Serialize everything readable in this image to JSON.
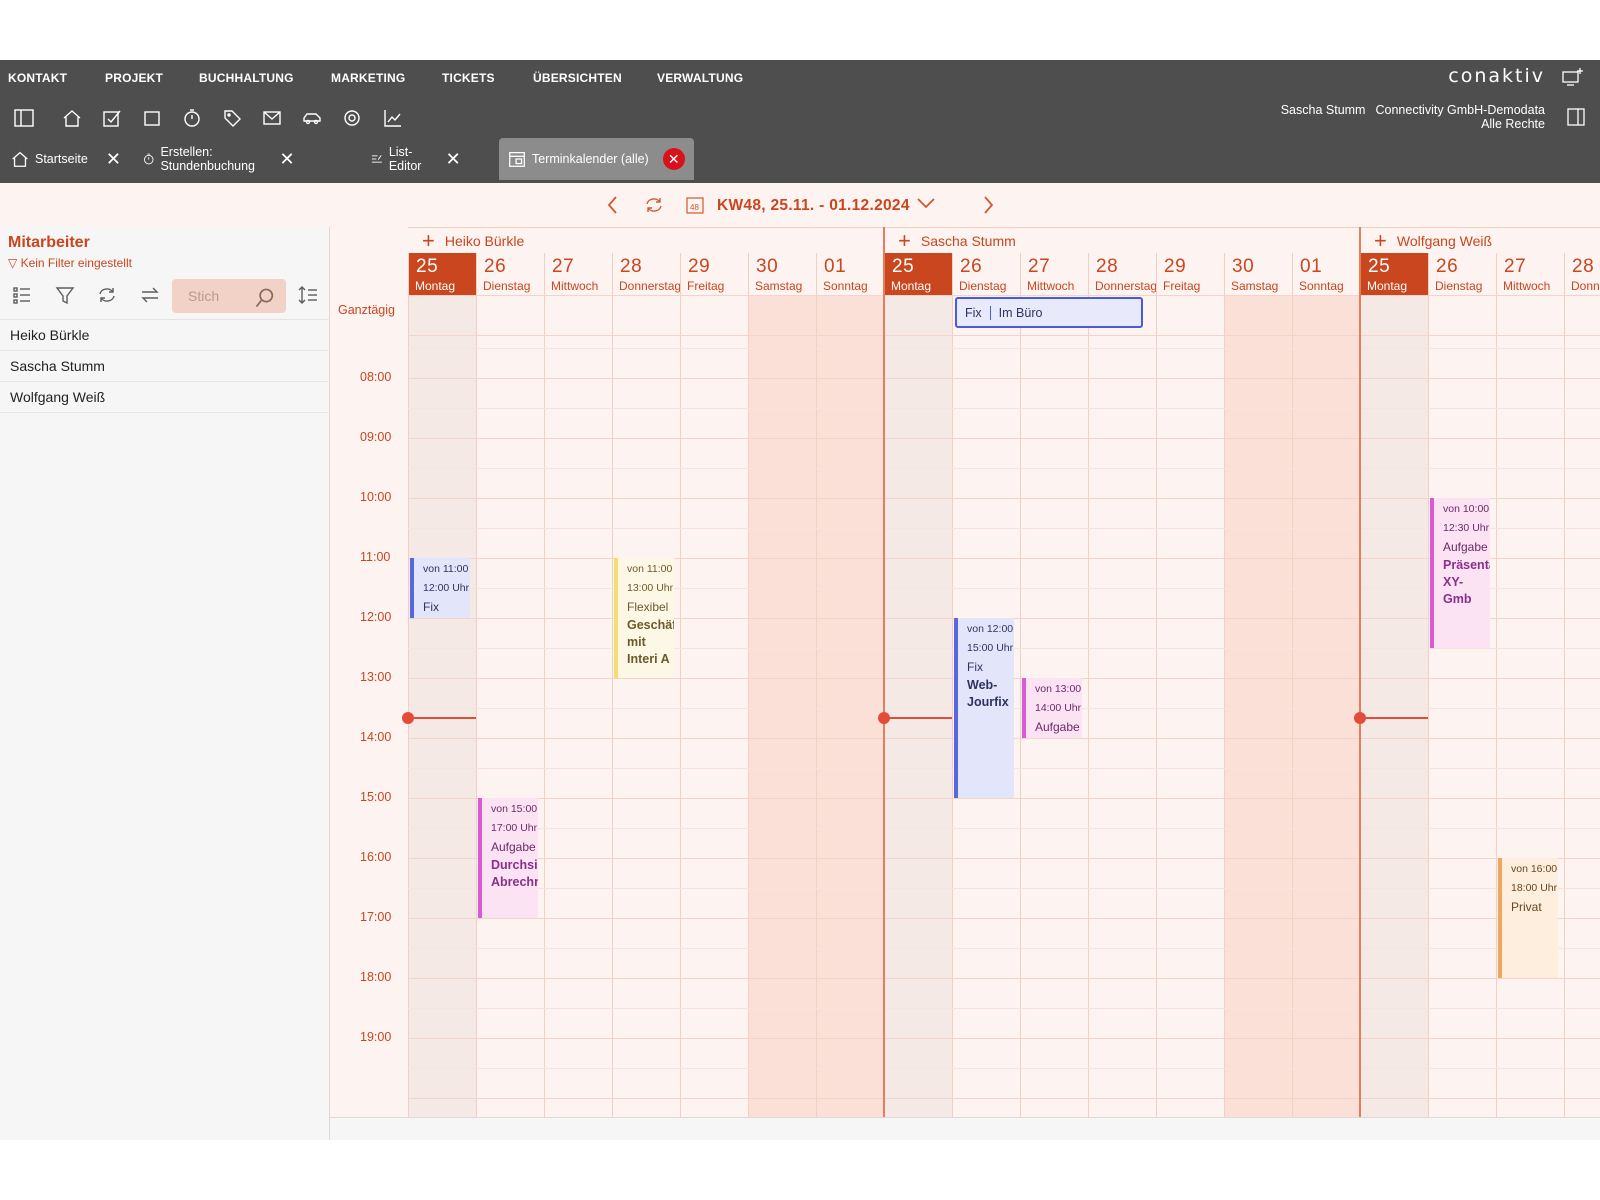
{
  "menu": [
    "KONTAKT",
    "PROJEKT",
    "BUCHHALTUNG",
    "MARKETING",
    "TICKETS",
    "ÜBERSICHTEN",
    "VERWALTUNG"
  ],
  "logo": "conaktiv",
  "user": {
    "name": "Sascha Stumm",
    "company": "Connectivity GmbH-Demodata",
    "rights": "Alle Rechte"
  },
  "toolbar_icons": [
    "panel-toggle-icon",
    "home-icon",
    "task-icon",
    "square-icon",
    "stopwatch-icon",
    "tag-icon",
    "mail-icon",
    "car-icon",
    "gear-icon",
    "chart-icon"
  ],
  "tabs": [
    {
      "label": "Startseite",
      "icon": "home-icon"
    },
    {
      "label": "Erstellen: Stundenbuchung",
      "icon": "stopwatch-icon"
    },
    {
      "label": "List-Editor",
      "icon": "list-edit-icon"
    },
    {
      "label": "Terminkalender (alle)",
      "icon": "calendar-icon",
      "active": true
    }
  ],
  "week": {
    "label": "KW48, 25.11. - 01.12.2024",
    "badge": "48"
  },
  "sidebar": {
    "title": "Mitarbeiter",
    "filter": "Kein Filter eingestellt",
    "search_placeholder": "Stich",
    "employees": [
      "Heiko Bürkle",
      "Sascha Stumm",
      "Wolfgang Weiß"
    ]
  },
  "calendar": {
    "allday_label": "Ganztägig",
    "times": [
      "08:00",
      "09:00",
      "10:00",
      "11:00",
      "12:00",
      "13:00",
      "14:00",
      "15:00",
      "16:00",
      "17:00",
      "18:00",
      "19:00"
    ],
    "persons": [
      "Heiko Bürkle",
      "Sascha Stumm",
      "Wolfgang Weiß"
    ],
    "days": [
      {
        "num": "25",
        "name": "Montag"
      },
      {
        "num": "26",
        "name": "Dienstag"
      },
      {
        "num": "27",
        "name": "Mittwoch"
      },
      {
        "num": "28",
        "name": "Donnerstag"
      },
      {
        "num": "29",
        "name": "Freitag"
      },
      {
        "num": "30",
        "name": "Samstag"
      },
      {
        "num": "01",
        "name": "Sonntag"
      }
    ],
    "allday_event": {
      "type": "Fix",
      "title": "Im Büro"
    },
    "events": [
      {
        "from": "von 11:00",
        "to": "12:00 Uhr",
        "type": "Fix",
        "sub": ""
      },
      {
        "from": "von 11:00",
        "to": "13:00 Uhr",
        "type": "Flexibel",
        "sub": "Geschäf mit Interi A"
      },
      {
        "from": "von 15:00",
        "to": "17:00 Uhr",
        "type": "Aufgabe",
        "sub": "Durchsic Abrechn"
      },
      {
        "from": "von 12:00",
        "to": "15:00 Uhr",
        "type": "Fix",
        "sub": "Web-Jourfix"
      },
      {
        "from": "von 13:00",
        "to": "14:00 Uhr",
        "type": "Aufgabe",
        "sub": ""
      },
      {
        "from": "von 10:00",
        "to": "12:30 Uhr",
        "type": "Aufgabe",
        "sub": "Präsenta XY-Gmb"
      },
      {
        "from": "von 16:00",
        "to": "18:00 Uhr",
        "type": "Privat",
        "sub": ""
      }
    ]
  },
  "colors": {
    "accent": "#c9461f",
    "topbar": "#4e4e4e",
    "weekend": "#fbe0d8",
    "now": "#e24c38"
  }
}
